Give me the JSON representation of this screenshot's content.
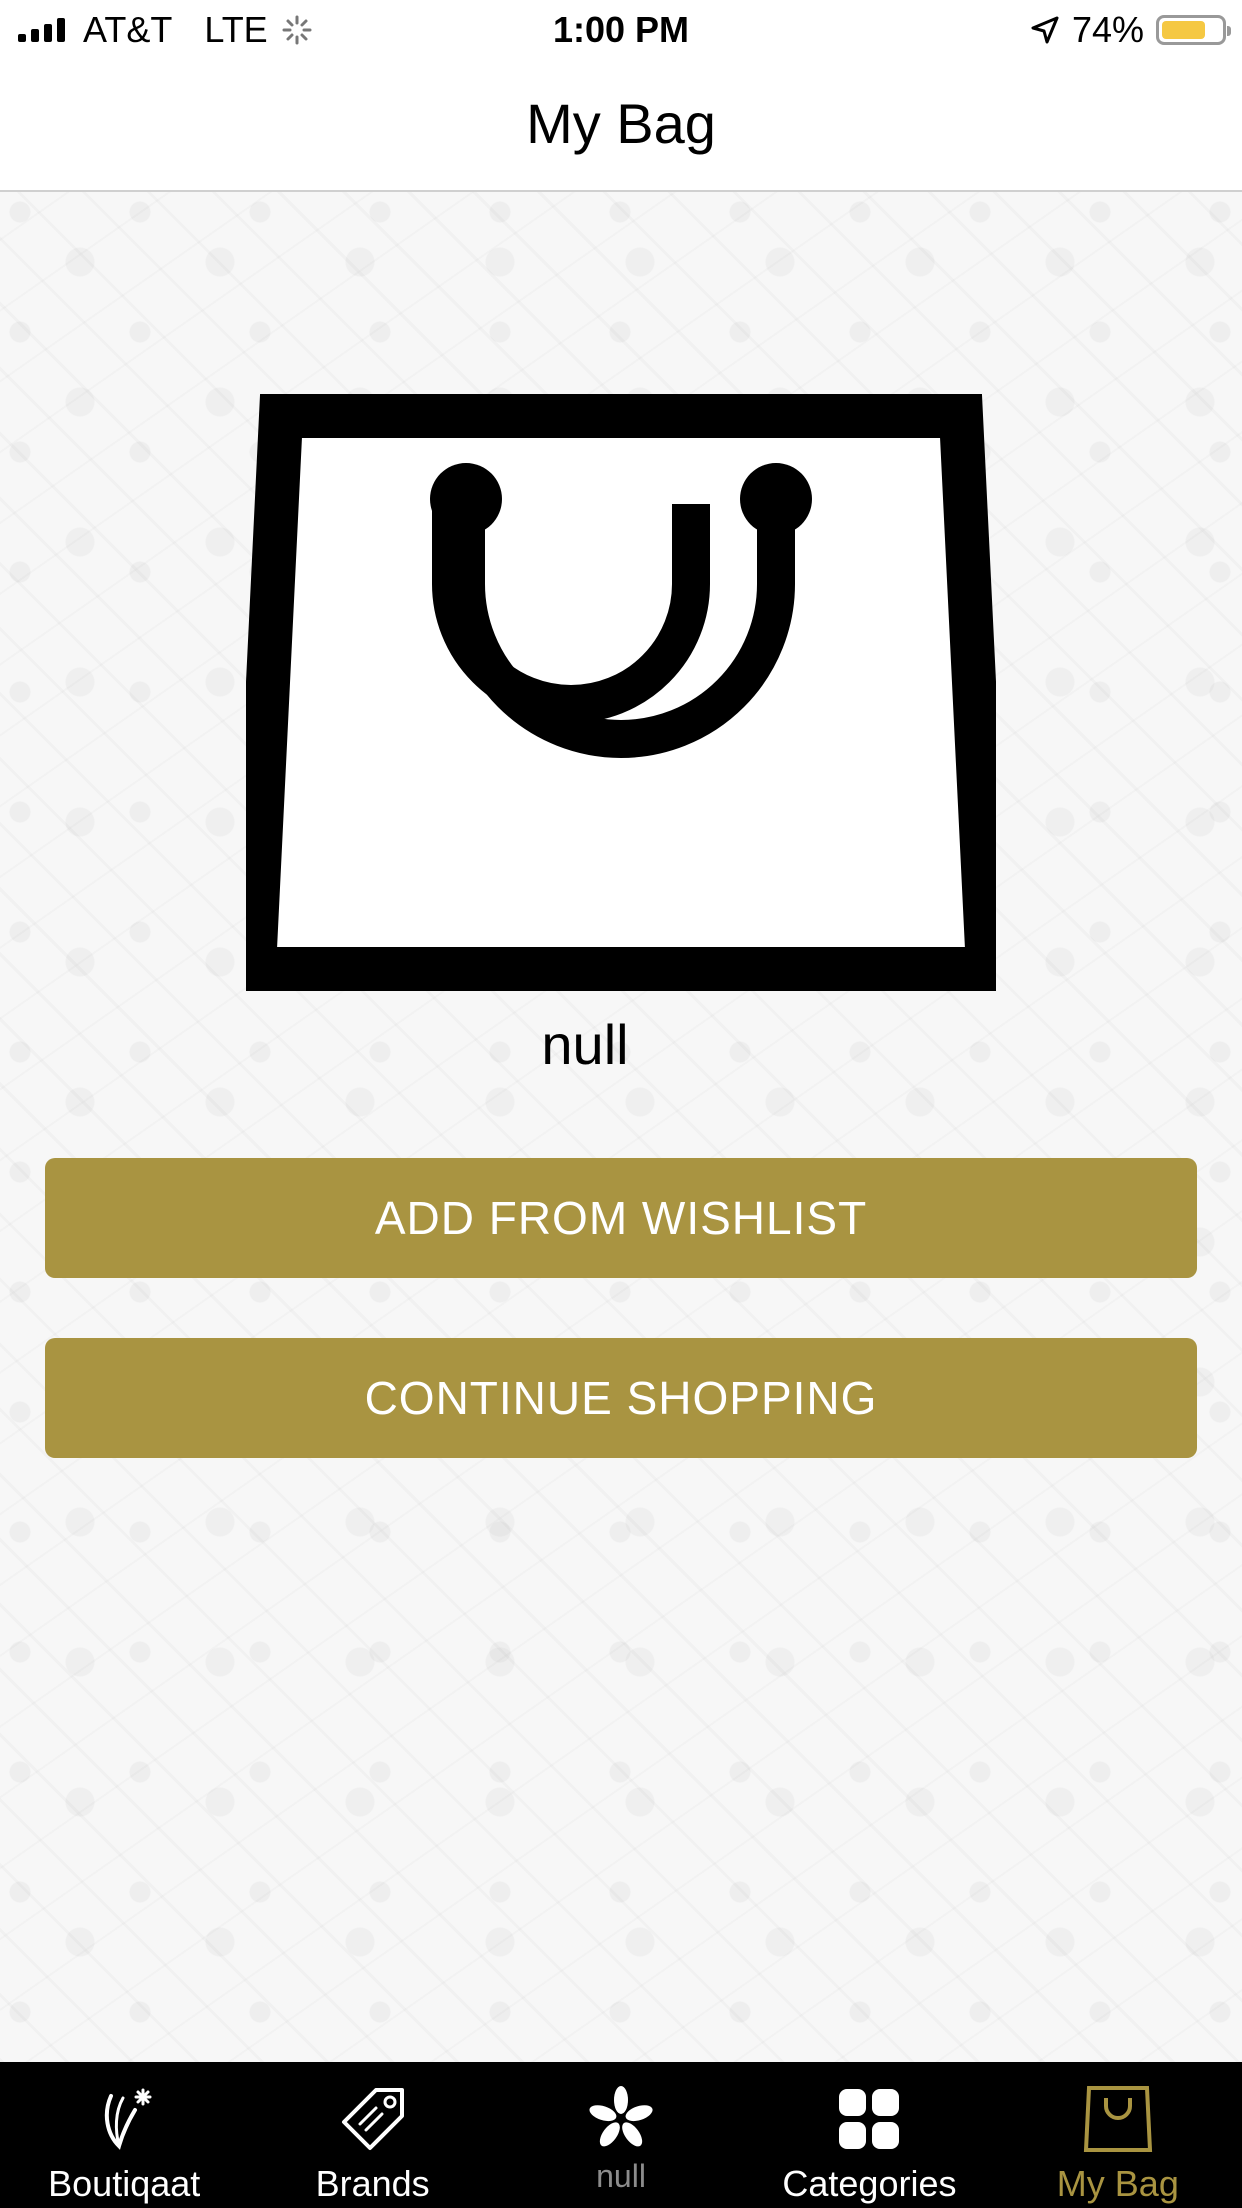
{
  "status_bar": {
    "carrier": "AT&T",
    "network": "LTE",
    "time": "1:00 PM",
    "battery_percent": "74%",
    "battery_level": 0.74,
    "battery_color": "#f5c842"
  },
  "nav": {
    "title": "My Bag"
  },
  "empty_state": {
    "icon": "shopping-bag-icon",
    "message": "null"
  },
  "buttons": {
    "add_from_wishlist": "ADD FROM WISHLIST",
    "continue_shopping": "CONTINUE SHOPPING"
  },
  "theme": {
    "accent": "#a99441",
    "tab_bar_bg": "#000000"
  },
  "tabs": [
    {
      "label": "Boutiqaat",
      "icon": "boutiqaat-logo-icon",
      "active": false
    },
    {
      "label": "Brands",
      "icon": "tag-icon",
      "active": false
    },
    {
      "label": "null",
      "icon": "flower-icon",
      "active": false
    },
    {
      "label": "Categories",
      "icon": "grid-icon",
      "active": false
    },
    {
      "label": "My Bag",
      "icon": "bag-icon",
      "active": true
    }
  ]
}
